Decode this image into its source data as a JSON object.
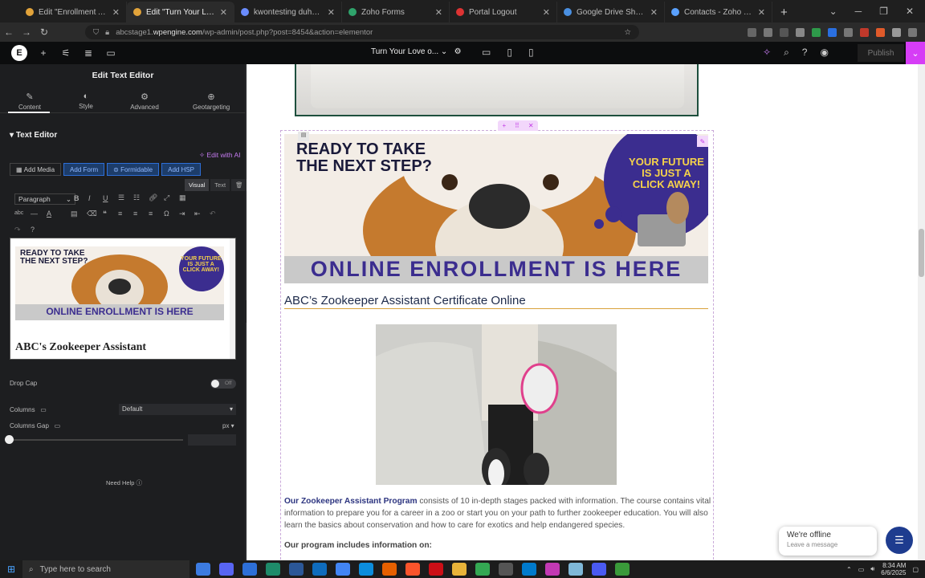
{
  "browser": {
    "tabs": [
      {
        "label": "Edit \"Enrollment Agreement A…",
        "color": "#e2a33a",
        "active": false
      },
      {
        "label": "Edit \"Turn Your Love of Animal…",
        "color": "#e2a33a",
        "active": true
      },
      {
        "label": "kwontesting duhn (Contact) · Z",
        "color": "#6a8cff",
        "active": false
      },
      {
        "label": "Zoho Forms",
        "color": "#2fa36b",
        "active": false
      },
      {
        "label": "Portal Logout",
        "color": "#d33",
        "active": false
      },
      {
        "label": "Google Drive Share Files Onlin…",
        "color": "#4a90e2",
        "active": false
      },
      {
        "label": "Contacts - Zoho CRM",
        "color": "#5aa1ff",
        "active": false
      }
    ],
    "url_prefix": "abcstage1.",
    "url_host": "wpengine.com",
    "url_path": "/wp-admin/post.php?post=8454&action=elementor"
  },
  "elementor": {
    "doc_title": "Turn Your Love o...",
    "publish_label": "Publish"
  },
  "panel": {
    "title": "Edit Text Editor",
    "tabs": [
      {
        "label": "Content",
        "icon": "✎"
      },
      {
        "label": "Style",
        "icon": "◐"
      },
      {
        "label": "Advanced",
        "icon": "⚙"
      },
      {
        "label": "Geotargeting",
        "icon": "⊕"
      }
    ],
    "section_header": "Text Editor",
    "edit_with_ai": "Edit with AI",
    "media_buttons": [
      "Add Media",
      "Add Form",
      "Formidable",
      "Add HSP"
    ],
    "mode_tabs": [
      "Visual",
      "Text"
    ],
    "paragraph_select": "Paragraph",
    "editor_heading": "ABC's Zookeeper Assistant",
    "drop_cap_label": "Drop Cap",
    "drop_cap_value": "Off",
    "columns_label": "Columns",
    "columns_value": "Default",
    "columns_gap_label": "Columns Gap",
    "columns_gap_unit": "px",
    "need_help": "Need Help"
  },
  "banner": {
    "headline_1": "READY TO TAKE",
    "headline_2": "THE NEXT STEP?",
    "bubble_1": "YOUR FUTURE",
    "bubble_2": "IS JUST A",
    "bubble_3": "CLICK AWAY!",
    "bottom_text": "ONLINE ENROLLMENT IS HERE"
  },
  "content": {
    "cert_title": "ABC’s Zookeeper Assistant Certificate Online",
    "para_bold": "Our Zookeeper Assistant Program",
    "para_rest": " consists of 10 in-depth stages packed with information. The course contains vital information to prepare you for a career in a zoo or start you on your path to further zookeeper education. You will also learn the basics about conservation and how to care for exotics and help endangered species.",
    "program_heading": "Our program includes information on:"
  },
  "chat": {
    "status": "We're offline",
    "action": "Leave a message"
  },
  "taskbar": {
    "search_placeholder": "Type here to search",
    "time": "8:34 AM",
    "date": "6/6/2025"
  },
  "colors": {
    "accent": "#d63df6",
    "navy": "#2d3580",
    "banner_purple": "#3b2d8f",
    "gold": "#f5d24a"
  }
}
